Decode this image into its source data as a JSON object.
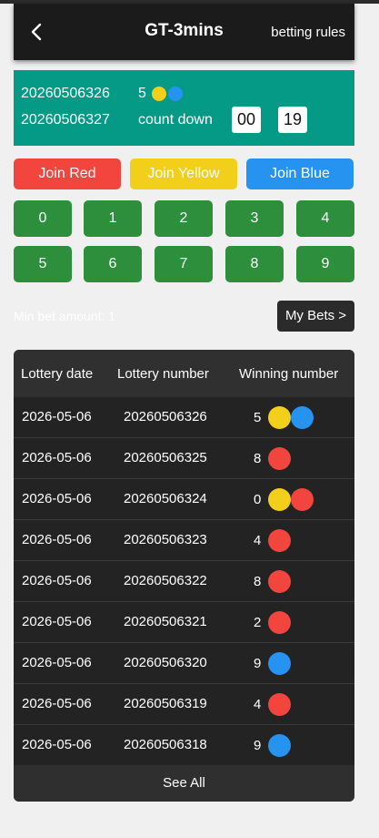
{
  "header": {
    "title": "GT-3mins",
    "rules_label": "betting rules"
  },
  "current": {
    "prev_period": "20260506326",
    "prev_number": "5",
    "prev_colors": [
      "#f1cf1b",
      "#2693f0"
    ],
    "next_period": "20260506327",
    "countdown_label": "count down",
    "countdown_min": "00",
    "countdown_sec": "19"
  },
  "colors": {
    "red": "#f1453d",
    "yellow": "#f1cf1b",
    "blue": "#2693f0",
    "green": "#2d8f3c",
    "teal": "#059a85"
  },
  "join_buttons": [
    {
      "label": "Join Red",
      "color": "#f1453d"
    },
    {
      "label": "Join Yellow",
      "color": "#f1cf1b"
    },
    {
      "label": "Join Blue",
      "color": "#2693f0"
    }
  ],
  "numbers": [
    "0",
    "1",
    "2",
    "3",
    "4",
    "5",
    "6",
    "7",
    "8",
    "9"
  ],
  "min_bet_label": "Min bet amount: 1",
  "my_bets_label": "My Bets >",
  "table": {
    "headers": [
      "Lottery date",
      "Lottery number",
      "Winning number"
    ],
    "rows": [
      {
        "date": "2026-05-06",
        "number": "20260506326",
        "win": "5",
        "colors": [
          "#f1cf1b",
          "#2693f0"
        ]
      },
      {
        "date": "2026-05-06",
        "number": "20260506325",
        "win": "8",
        "colors": [
          "#f1453d"
        ]
      },
      {
        "date": "2026-05-06",
        "number": "20260506324",
        "win": "0",
        "colors": [
          "#f1cf1b",
          "#f1453d"
        ]
      },
      {
        "date": "2026-05-06",
        "number": "20260506323",
        "win": "4",
        "colors": [
          "#f1453d"
        ]
      },
      {
        "date": "2026-05-06",
        "number": "20260506322",
        "win": "8",
        "colors": [
          "#f1453d"
        ]
      },
      {
        "date": "2026-05-06",
        "number": "20260506321",
        "win": "2",
        "colors": [
          "#f1453d"
        ]
      },
      {
        "date": "2026-05-06",
        "number": "20260506320",
        "win": "9",
        "colors": [
          "#2693f0"
        ]
      },
      {
        "date": "2026-05-06",
        "number": "20260506319",
        "win": "4",
        "colors": [
          "#f1453d"
        ]
      },
      {
        "date": "2026-05-06",
        "number": "20260506318",
        "win": "9",
        "colors": [
          "#2693f0"
        ]
      }
    ],
    "see_all_label": "See All"
  }
}
